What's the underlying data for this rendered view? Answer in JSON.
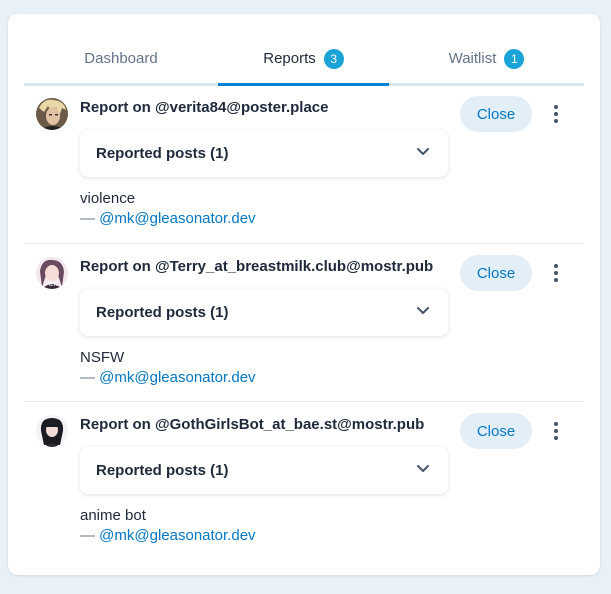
{
  "tabs": [
    {
      "label": "Dashboard",
      "count": null
    },
    {
      "label": "Reports",
      "count": "3"
    },
    {
      "label": "Waitlist",
      "count": "1"
    }
  ],
  "reports": [
    {
      "title": "Report on @verita84@poster.place",
      "close_label": "Close",
      "accordion_label": "Reported posts (1)",
      "reason": "violence",
      "reporter_prefix": "—",
      "reporter": "@mk@gleasonator.dev"
    },
    {
      "title": "Report on @Terry_at_breastmilk.club@mostr.pub",
      "close_label": "Close",
      "accordion_label": "Reported posts (1)",
      "reason": "NSFW",
      "reporter_prefix": "—",
      "reporter": "@mk@gleasonator.dev"
    },
    {
      "title": "Report on @GothGirlsBot_at_bae.st@mostr.pub",
      "close_label": "Close",
      "accordion_label": "Reported posts (1)",
      "reason": "anime bot",
      "reporter_prefix": "—",
      "reporter": "@mk@gleasonator.dev"
    }
  ],
  "colors": {
    "accent": "#0482d8",
    "badge": "#1aa3d6",
    "link": "#0477c4"
  }
}
